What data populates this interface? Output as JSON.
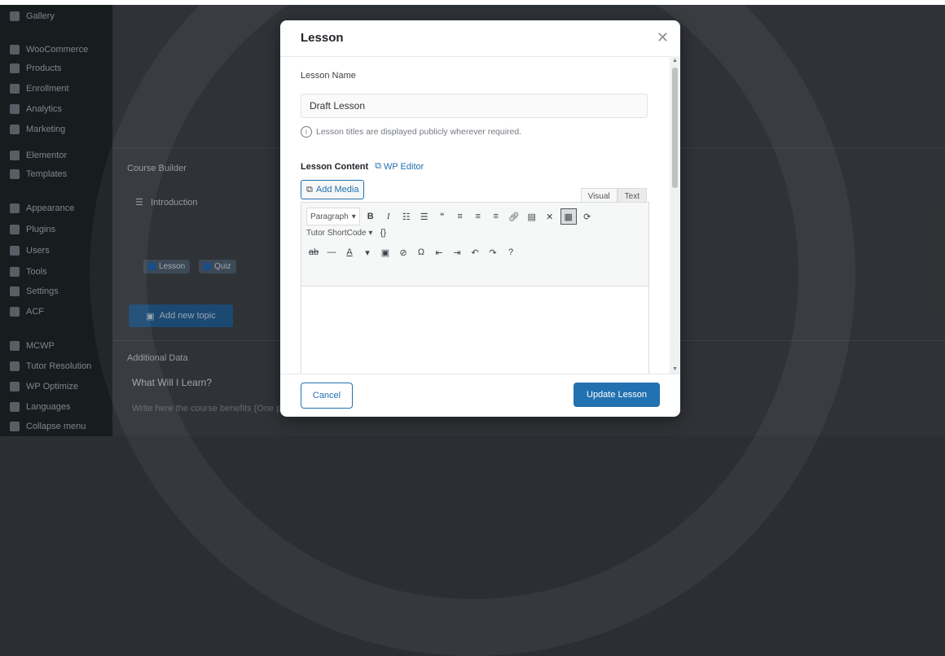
{
  "sidebar": {
    "items": [
      {
        "label": "Gallery",
        "icon": "gallery-icon"
      },
      {
        "label": "WooCommerce",
        "icon": "woocommerce-icon"
      },
      {
        "label": "Products",
        "icon": "products-icon"
      },
      {
        "label": "Enrollment",
        "icon": "enrollment-icon"
      },
      {
        "label": "Analytics",
        "icon": "analytics-icon"
      },
      {
        "label": "Marketing",
        "icon": "marketing-icon"
      },
      {
        "label": "Elementor",
        "icon": "elementor-icon"
      },
      {
        "label": "Templates",
        "icon": "templates-icon"
      },
      {
        "label": "Appearance",
        "icon": "appearance-icon"
      },
      {
        "label": "Plugins",
        "icon": "plugins-icon"
      },
      {
        "label": "Users",
        "icon": "users-icon"
      },
      {
        "label": "Tools",
        "icon": "tools-icon"
      },
      {
        "label": "Settings",
        "icon": "settings-icon"
      },
      {
        "label": "ACF",
        "icon": "acf-icon"
      },
      {
        "label": "MCWP",
        "icon": "mcwp-icon"
      },
      {
        "label": "Tutor Resolution",
        "icon": "tutor-icon"
      },
      {
        "label": "WP Optimize",
        "icon": "optimize-icon"
      },
      {
        "label": "Languages",
        "icon": "languages-icon"
      },
      {
        "label": "Collapse menu",
        "icon": "collapse-icon"
      }
    ]
  },
  "background": {
    "course_builder": "Course Builder",
    "topic": "Introduction",
    "lesson_btn": "Lesson",
    "quiz_btn": "Quiz",
    "add_topic": "Add new topic",
    "additional_data": "Additional Data",
    "what_will_learn": "What Will I Learn?",
    "benefits_placeholder": "Write here the course benefits (One per line)"
  },
  "modal": {
    "title": "Lesson",
    "lesson_name_label": "Lesson Name",
    "lesson_name_value": "Draft Lesson",
    "hint": "Lesson titles are displayed publicly wherever required.",
    "content_label": "Lesson Content",
    "wp_editor": "WP Editor",
    "add_media": "Add Media",
    "tab_visual": "Visual",
    "tab_text": "Text",
    "format_select": "Paragraph",
    "shortcode_select": "Tutor ShortCode",
    "cancel": "Cancel",
    "update": "Update Lesson"
  },
  "colors": {
    "accent": "#2271b1",
    "sidebar_bg": "#1d2327"
  }
}
